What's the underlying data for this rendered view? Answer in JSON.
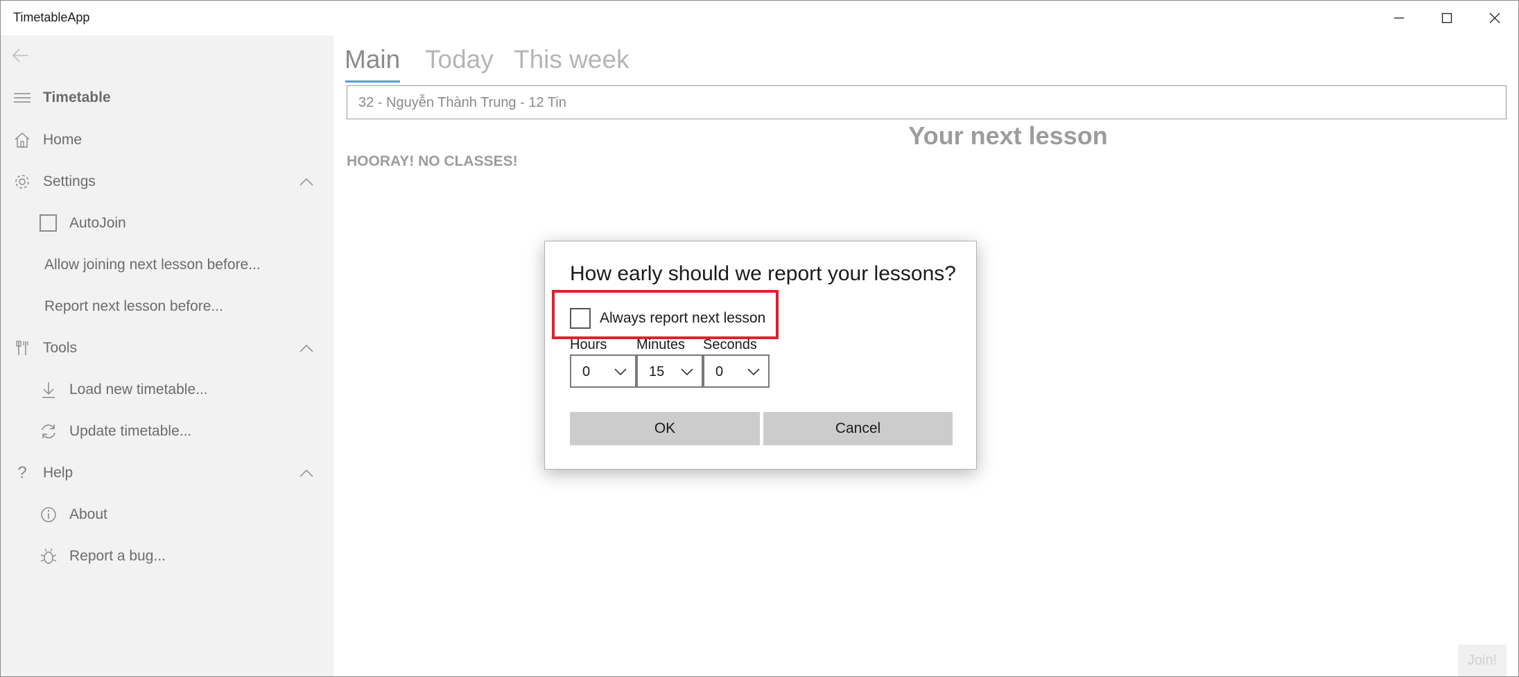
{
  "window": {
    "title": "TimetableApp"
  },
  "sidebar": {
    "header": "Timetable",
    "items": [
      {
        "label": "Home",
        "icon": "home-icon"
      },
      {
        "label": "Settings",
        "icon": "gear-icon"
      },
      {
        "label": "AutoJoin",
        "icon": "checkbox"
      },
      {
        "label": "Allow joining next lesson before..."
      },
      {
        "label": "Report next lesson before..."
      },
      {
        "label": "Tools",
        "icon": "tools-icon"
      },
      {
        "label": "Load new timetable...",
        "icon": "download-icon"
      },
      {
        "label": "Update timetable...",
        "icon": "refresh-icon"
      },
      {
        "label": "Help",
        "icon": "help-icon"
      },
      {
        "label": "About",
        "icon": "info-icon"
      },
      {
        "label": "Report a bug...",
        "icon": "bug-icon"
      }
    ]
  },
  "main": {
    "tabs": [
      {
        "label": "Main",
        "active": true
      },
      {
        "label": "Today",
        "active": false
      },
      {
        "label": "This week",
        "active": false
      }
    ],
    "student": "32 - Nguyễn Thành Trung - 12 Tin",
    "next_lesson_title": "Your next lesson",
    "status": "HOORAY! NO CLASSES!",
    "join_label": "Join!"
  },
  "dialog": {
    "title": "How early should we report your lessons?",
    "always_report_label": "Always report next lesson",
    "always_report_checked": false,
    "hours_label": "Hours",
    "hours_value": "0",
    "minutes_label": "Minutes",
    "minutes_value": "15",
    "seconds_label": "Seconds",
    "seconds_value": "0",
    "ok_label": "OK",
    "cancel_label": "Cancel"
  },
  "colors": {
    "accent": "#5a9bd8",
    "highlight": "#e0212e",
    "sidebar_bg": "#f2f2f2"
  }
}
